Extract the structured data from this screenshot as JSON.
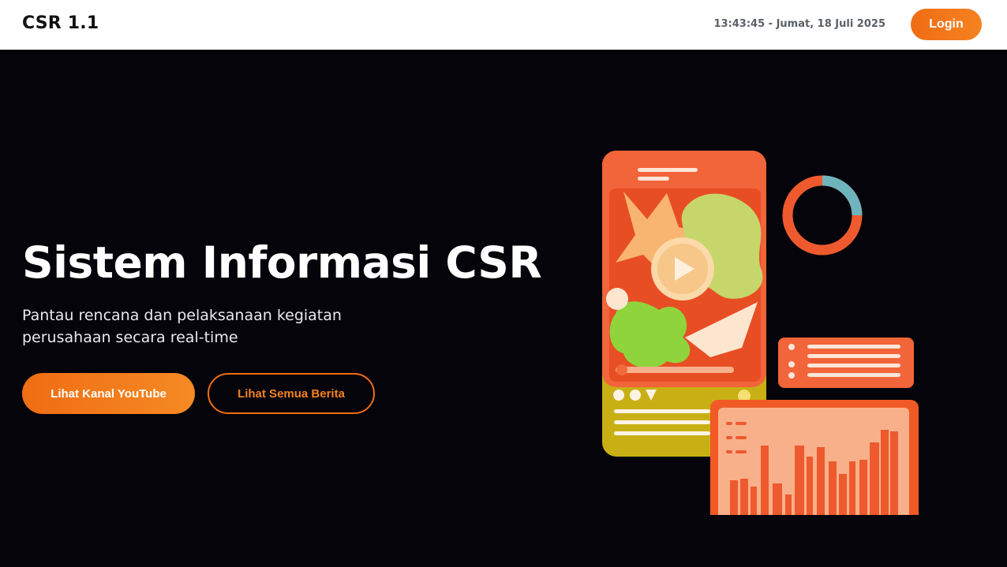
{
  "header": {
    "brand": "CSR 1.1",
    "datetime": "13:43:45 - Jumat, 18 Juli 2025",
    "login_label": "Login"
  },
  "hero": {
    "title": "Sistem Informasi CSR",
    "subtitle": "Pantau rencana dan pelaksanaan kegiatan perusahaan secara real-time",
    "youtube_button": "Lihat Kanal YouTube",
    "news_button": "Lihat Semua Berita"
  },
  "colors": {
    "accent": "#f06d13",
    "background": "#04040a",
    "header_bg": "#ffffff"
  }
}
